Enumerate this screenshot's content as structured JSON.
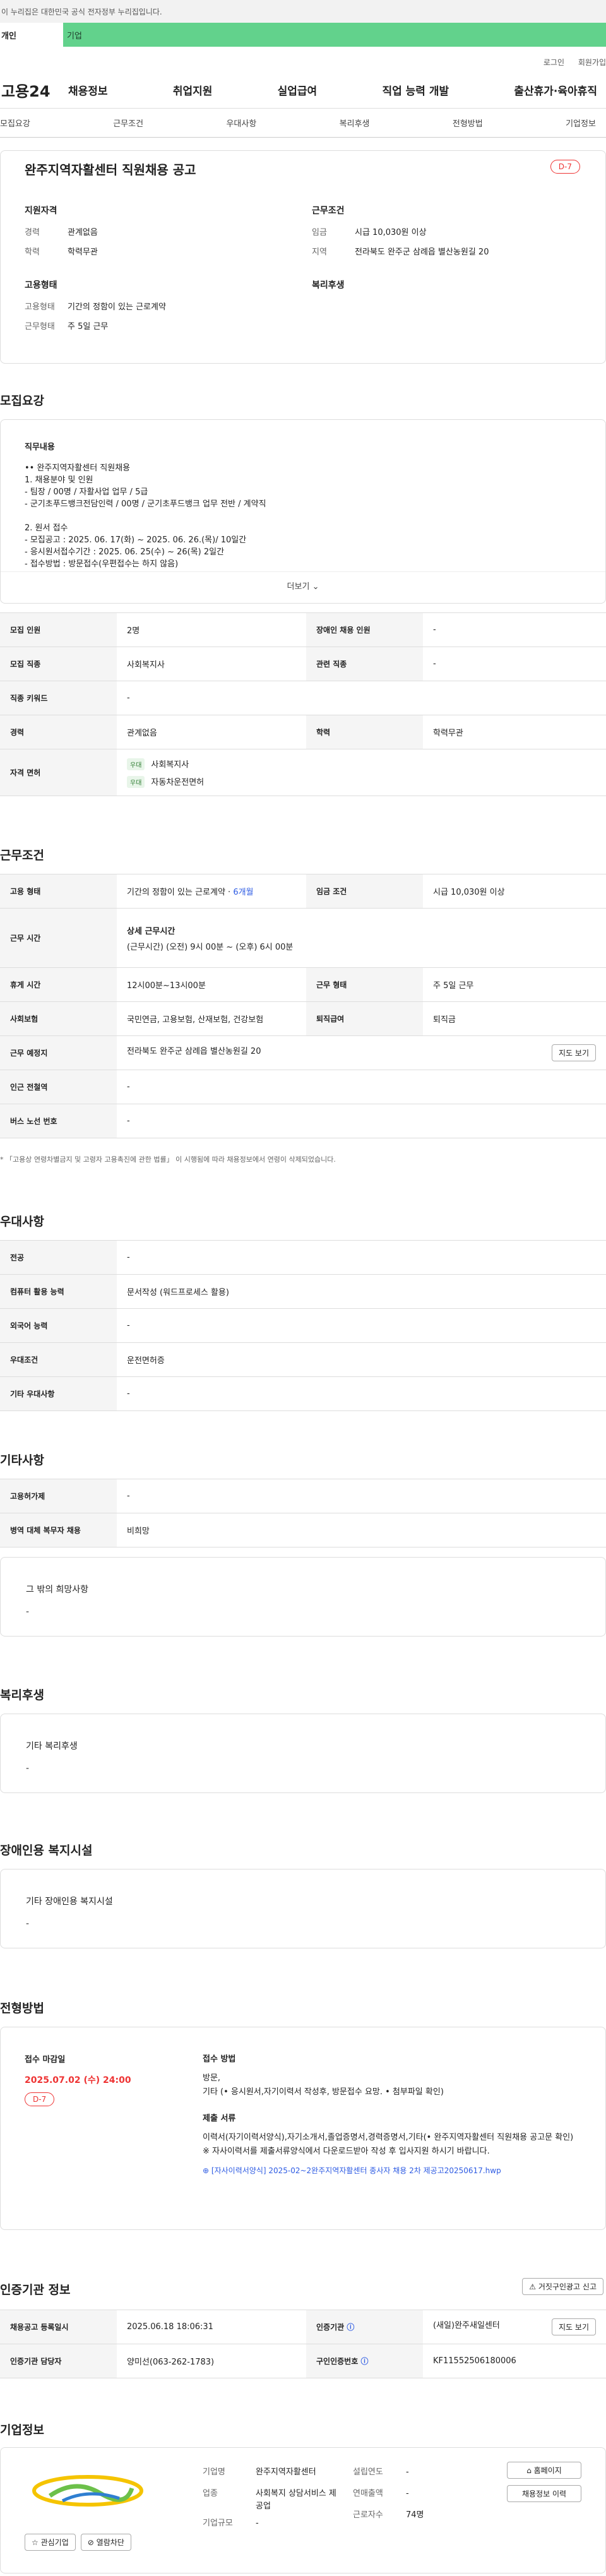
{
  "gov_banner": "이 누리집은 대한민국 공식 전자정부 누리집입니다.",
  "userbar": {
    "individual": "개인",
    "company": "기업"
  },
  "util": [
    "로그인",
    "회원가입"
  ],
  "logo": "고용24",
  "gnb": [
    "채용정보",
    "취업지원",
    "실업급여",
    "직업 능력 개발",
    "출산휴가·육아휴직"
  ],
  "tabs": [
    "모집요강",
    "근무조건",
    "우대사항",
    "복리후생",
    "전형방법",
    "기업정보"
  ],
  "summary": {
    "title": "완주지역자활센터 직원채용 공고",
    "dday": "D-7",
    "qual_title": "지원자격",
    "career_k": "경력",
    "career_v": "관계없음",
    "edu_k": "학력",
    "edu_v": "학력무관",
    "cond_title": "근무조건",
    "wage_k": "임금",
    "wage_v": "시급 10,030원 이상",
    "region_k": "지역",
    "region_v": "전라북도 완주군 삼례읍 별산농원길 20",
    "emp_title": "고용형태",
    "emptype_k": "고용형태",
    "emptype_v": "기간의 정함이 있는 근로계약",
    "worktype_k": "근무형태",
    "worktype_v": "주 5일 근무",
    "welfare_title": "복리후생"
  },
  "recruit": {
    "title": "모집요강",
    "duty_title": "직무내용",
    "duty_lines": [
      "•• 완주지역자활센터 직원채용",
      "1. 채용분야 및 인원",
      " - 팀장 / 00명 / 자활사업 업무 / 5급",
      " - 군기초푸드뱅크전담인력 / 00명 / 군기초푸드뱅크 업무 전반 / 계약직",
      "",
      "2. 원서 접수",
      " - 모집공고 : 2025. 06. 17(화) ~ 2025. 06. 26.(목)/ 10일간",
      "  - 응시원서접수기간 : 2025. 06. 25(수) ~ 26(목) 2일간",
      "  - 접수방법 : 방문접수(우편접수는 하지 않음)"
    ],
    "more": "더보기",
    "rows": [
      {
        "k1": "모집 인원",
        "v1": "2명",
        "k2": "장애인 채용 인원",
        "v2": "-"
      },
      {
        "k1": "모집 직종",
        "v1": "사회복지사",
        "k2": "관련 직종",
        "v2": "-"
      },
      {
        "k1": "직종 키워드",
        "v1": "-"
      },
      {
        "k1": "경력",
        "v1": "관계없음",
        "k2": "학력",
        "v2": "학력무관"
      }
    ],
    "license_k": "자격 면허",
    "licenses": [
      {
        "chip": "우대",
        "name": "사회복지사"
      },
      {
        "chip": "우대",
        "name": "자동차운전면허"
      }
    ]
  },
  "work": {
    "title": "근무조건",
    "emp_k": "고용 형태",
    "emp_v": "기간의 정함이 있는 근로계약 · ",
    "emp_months": "6개월",
    "wage_k": "임금 조건",
    "wage_v": "시급 10,030원 이상",
    "time_k": "근무 시간",
    "time_title": "상세 근무시간",
    "time_v": "(근무시간) (오전) 9시 00분 ~ (오후) 6시 00분",
    "break_k": "휴게 시간",
    "break_v": "12시00분~13시00분",
    "form_k": "근무 형태",
    "form_v": "주 5일 근무",
    "ins_k": "사회보험",
    "ins_v": "국민연금, 고용보험, 산재보험, 건강보험",
    "sev_k": "퇴직급여",
    "sev_v": "퇴직금",
    "place_k": "근무 예정지",
    "place_v": "전라북도 완주군 삼례읍 별산농원길 20",
    "map_btn": "지도 보기",
    "subway_k": "인근 전철역",
    "subway_v": "-",
    "bus_k": "버스 노선 번호",
    "bus_v": "-",
    "note": "* 「고용상 연령차별금지 및 고령자 고용촉진에 관한 법률」 이 시행됨에 따라 채용정보에서 연령이 삭제되었습니다."
  },
  "pref": {
    "title": "우대사항",
    "rows": [
      {
        "k": "전공",
        "v": "-"
      },
      {
        "k": "컴퓨터 활용 능력",
        "v": "문서작성 (워드프로세스 활용)"
      },
      {
        "k": "외국어 능력",
        "v": "-"
      },
      {
        "k": "우대조건",
        "v": "운전면허증"
      },
      {
        "k": "기타 우대사항",
        "v": "-"
      }
    ]
  },
  "etc": {
    "title": "기타사항",
    "rows": [
      {
        "k": "고용허가제",
        "v": "-"
      },
      {
        "k": "병역 대체 복무자 채용",
        "v": "비희망"
      }
    ],
    "other_title": "그 밖의 희망사항",
    "other_v": "-"
  },
  "welfare": {
    "title": "복리후생",
    "box_title": "기타 복리후생",
    "box_v": "-"
  },
  "disabled": {
    "title": "장애인용 복지시설",
    "box_title": "기타 장애인용 복지시설",
    "box_v": "-"
  },
  "apply": {
    "title": "전형방법",
    "deadline_title": "접수 마감일",
    "deadline": "2025.07.02 (수) 24:00",
    "dday": "D-7",
    "method_title": "접수 방법",
    "method_v1": "방문,",
    "method_v2": "기타 (• 응시원서,자기이력서 작성후, 방문접수 요망. • 첨부파일 확인)",
    "docs_title": "제출 서류",
    "docs_v": "이력서(자기이력서양식),자기소개서,졸업증명서,경력증명서,기타(• 완주지역자활센터 직원채용 공고문 확인)",
    "docs_note": "※ 자사이력서를 제출서류양식에서 다운로드받아 작성 후 입사지원 하시기 바랍니다.",
    "file": "[자사이력서양식] 2025-02~2완주지역자활센터 종사자 채용 2차 제공고20250617.hwp"
  },
  "cert": {
    "title": "인증기관 정보",
    "report_btn": "거짓구인광고 신고",
    "reg_k": "채용공고 등록일시",
    "reg_v": "2025.06.18 18:06:31",
    "org_k": "인증기관",
    "org_v": "(새일)완주새일센터",
    "map_btn": "지도 보기",
    "mgr_k": "인증기관 담당자",
    "mgr_v": "양미선(063-262-1783)",
    "cert_k": "구인인증번호",
    "cert_v": "KF11552506180006"
  },
  "company": {
    "title": "기업정보",
    "fav": "관심기업",
    "block": "열람차단",
    "name_k": "기업명",
    "name_v": "완주지역자활센터",
    "ind_k": "업종",
    "ind_v": "사회복지 상담서비스 제공업",
    "size_k": "기업규모",
    "size_v": "-",
    "year_k": "설립연도",
    "year_v": "-",
    "sales_k": "연매출액",
    "sales_v": "-",
    "emp_k": "근로자수",
    "emp_v": "74명",
    "home_btn": "홈페이지",
    "info_btn": "채용정보 이력"
  }
}
